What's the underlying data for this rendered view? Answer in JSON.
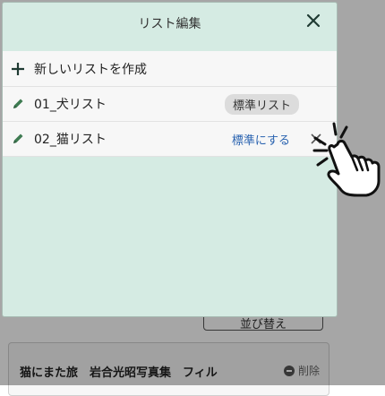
{
  "background": {
    "button_label": "並び替え",
    "card_title": "猫にまた旅　岩合光昭写真集　フィル",
    "card_delete": "削除"
  },
  "modal": {
    "title": "リスト編集",
    "add_label": "新しいリストを作成",
    "lists": [
      {
        "name": "01_犬リスト",
        "status": "標準リスト"
      },
      {
        "name": "02_猫リスト",
        "action": "標準にする"
      }
    ]
  },
  "icons": {
    "close": "close-icon",
    "plus": "plus-icon",
    "pencil": "pencil-icon",
    "hand": "pointing-hand-icon"
  },
  "colors": {
    "modal_bg": "#d5ebe3",
    "link": "#2a63b0",
    "badge_bg": "#dcdcdc"
  }
}
